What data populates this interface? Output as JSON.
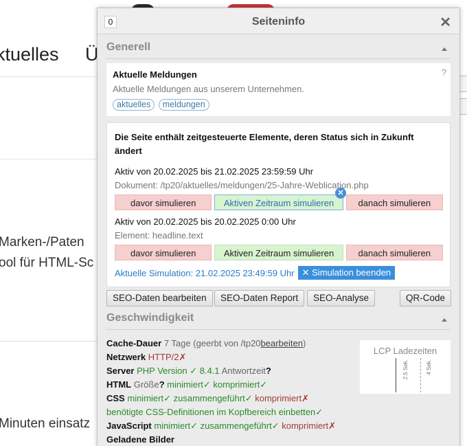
{
  "background": {
    "nav": [
      "ktuelles",
      "Ü"
    ],
    "lines": [
      "Marken-/Paten",
      "ool für HTML-Sc",
      "Minuten einsatz"
    ]
  },
  "panel": {
    "counter": "0",
    "title": "Seiteninfo",
    "close_glyph": "✕",
    "general": {
      "title": "Generell",
      "card_title": "Aktuelle Meldungen",
      "card_desc": "Aktuelle Meldungen aus unserem Unternehmen.",
      "help": "?",
      "tags": [
        "aktuelles",
        "meldungen"
      ]
    },
    "timed": {
      "warning": "Die Seite enthält zeitgesteuerte Elemente, deren Status sich in Zukunft ändert",
      "entries": [
        {
          "active": "Aktiv von 20.02.2025 bis 21.02.2025 23:59:59 Uhr",
          "source": "Dokument: /tp20/aktuelles/meldungen/25-Jahre-Weblication.php",
          "before": "davor simulieren",
          "during": "Aktiven Zeitraum simulieren",
          "after": "danach simulieren"
        },
        {
          "active": "Aktiv von 20.02.2025 bis 20.02.2025 0:00 Uhr",
          "source": "Element: headline.text",
          "before": "davor simulieren",
          "during": "Aktiven Zeitraum simulieren",
          "after": "danach simulieren"
        }
      ],
      "simulation_status": "Aktuelle Simulation: 21.02.2025 23:49:59 Uhr",
      "end_simulation": "✕ Simulation beenden"
    },
    "buttons": {
      "seo_edit": "SEO-Daten bearbeiten",
      "seo_report": "SEO-Daten Report",
      "seo_analysis": "SEO-Analyse",
      "qr": "QR-Code"
    },
    "speed": {
      "title": "Geschwindigkeit",
      "cache_label": "Cache-Dauer",
      "cache_value": "7 Tage (geerbt von /tp20",
      "cache_edit": "bearbeiten",
      "cache_close": ")",
      "network_label": "Netzwerk",
      "network_value": "HTTP/2",
      "server_label": "Server",
      "server_php": "PHP Version",
      "server_php_ver": "8.4.1",
      "server_response": "Antwortzeit",
      "html_label": "HTML",
      "html_size": "Größe",
      "html_min": "minimiert",
      "html_comp": "komprimiert",
      "css_label": "CSS",
      "css_min": "minimiert",
      "css_merged": "zusammengeführt",
      "css_comp": "komprimiert",
      "css_inline": "benötigte CSS-Definitionen im Kopfbereich einbetten",
      "js_label": "JavaScript",
      "js_min": "minimiert",
      "js_merged": "zusammengeführt",
      "js_comp": "komprimiert",
      "images_label": "Geladene Bilder",
      "check": "✓",
      "cross": "✗",
      "question": "?",
      "lcp_title": "LCP Ladezeiten",
      "lcp_mark1": "2.5 Sek.",
      "lcp_mark2": "4 Sek."
    }
  }
}
